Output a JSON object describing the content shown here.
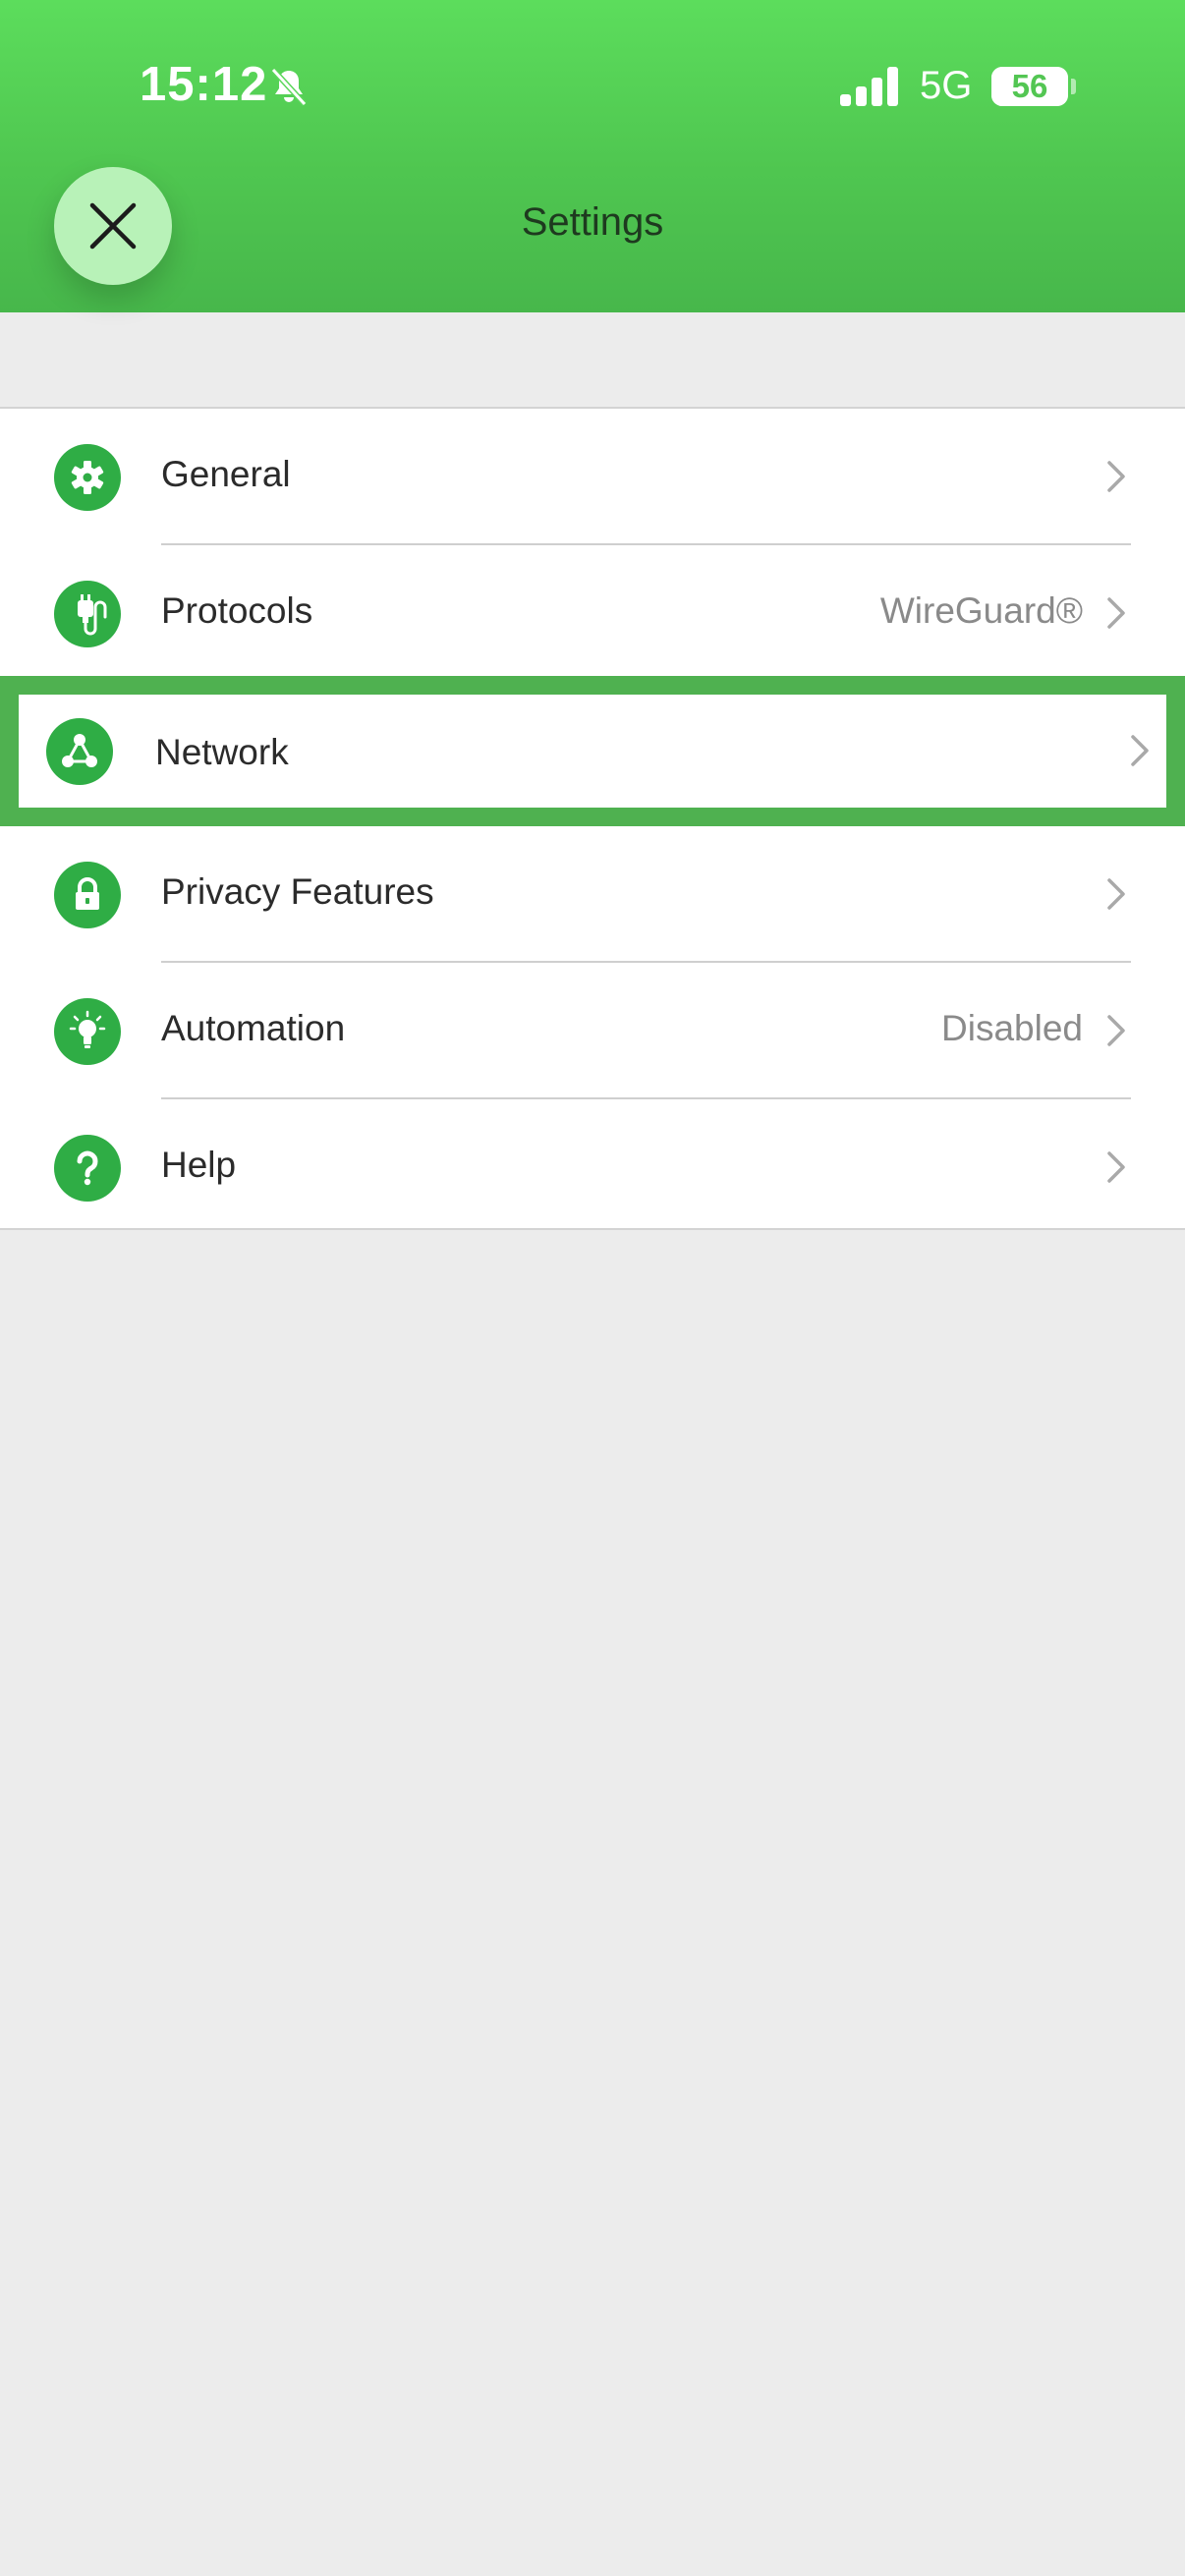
{
  "status_bar": {
    "time": "15:12",
    "network": "5G",
    "battery": "56",
    "battery_fraction": 0.56
  },
  "header": {
    "title": "Settings",
    "close_icon": "close-icon"
  },
  "settings": {
    "items": [
      {
        "label": "General",
        "value": "",
        "icon": "gear-icon"
      },
      {
        "label": "Protocols",
        "value": "WireGuard®",
        "icon": "protocol-plug-icon"
      },
      {
        "label": "Network",
        "value": "",
        "icon": "network-nodes-icon"
      },
      {
        "label": "Privacy Features",
        "value": "",
        "icon": "lock-icon"
      },
      {
        "label": "Automation",
        "value": "Disabled",
        "icon": "lightbulb-icon"
      },
      {
        "label": "Help",
        "value": "",
        "icon": "question-icon"
      }
    ]
  },
  "colors": {
    "header_green": "#5cdd5c",
    "icon_green": "#2fad45",
    "highlight_border": "#4fb150",
    "background": "#ececec"
  }
}
